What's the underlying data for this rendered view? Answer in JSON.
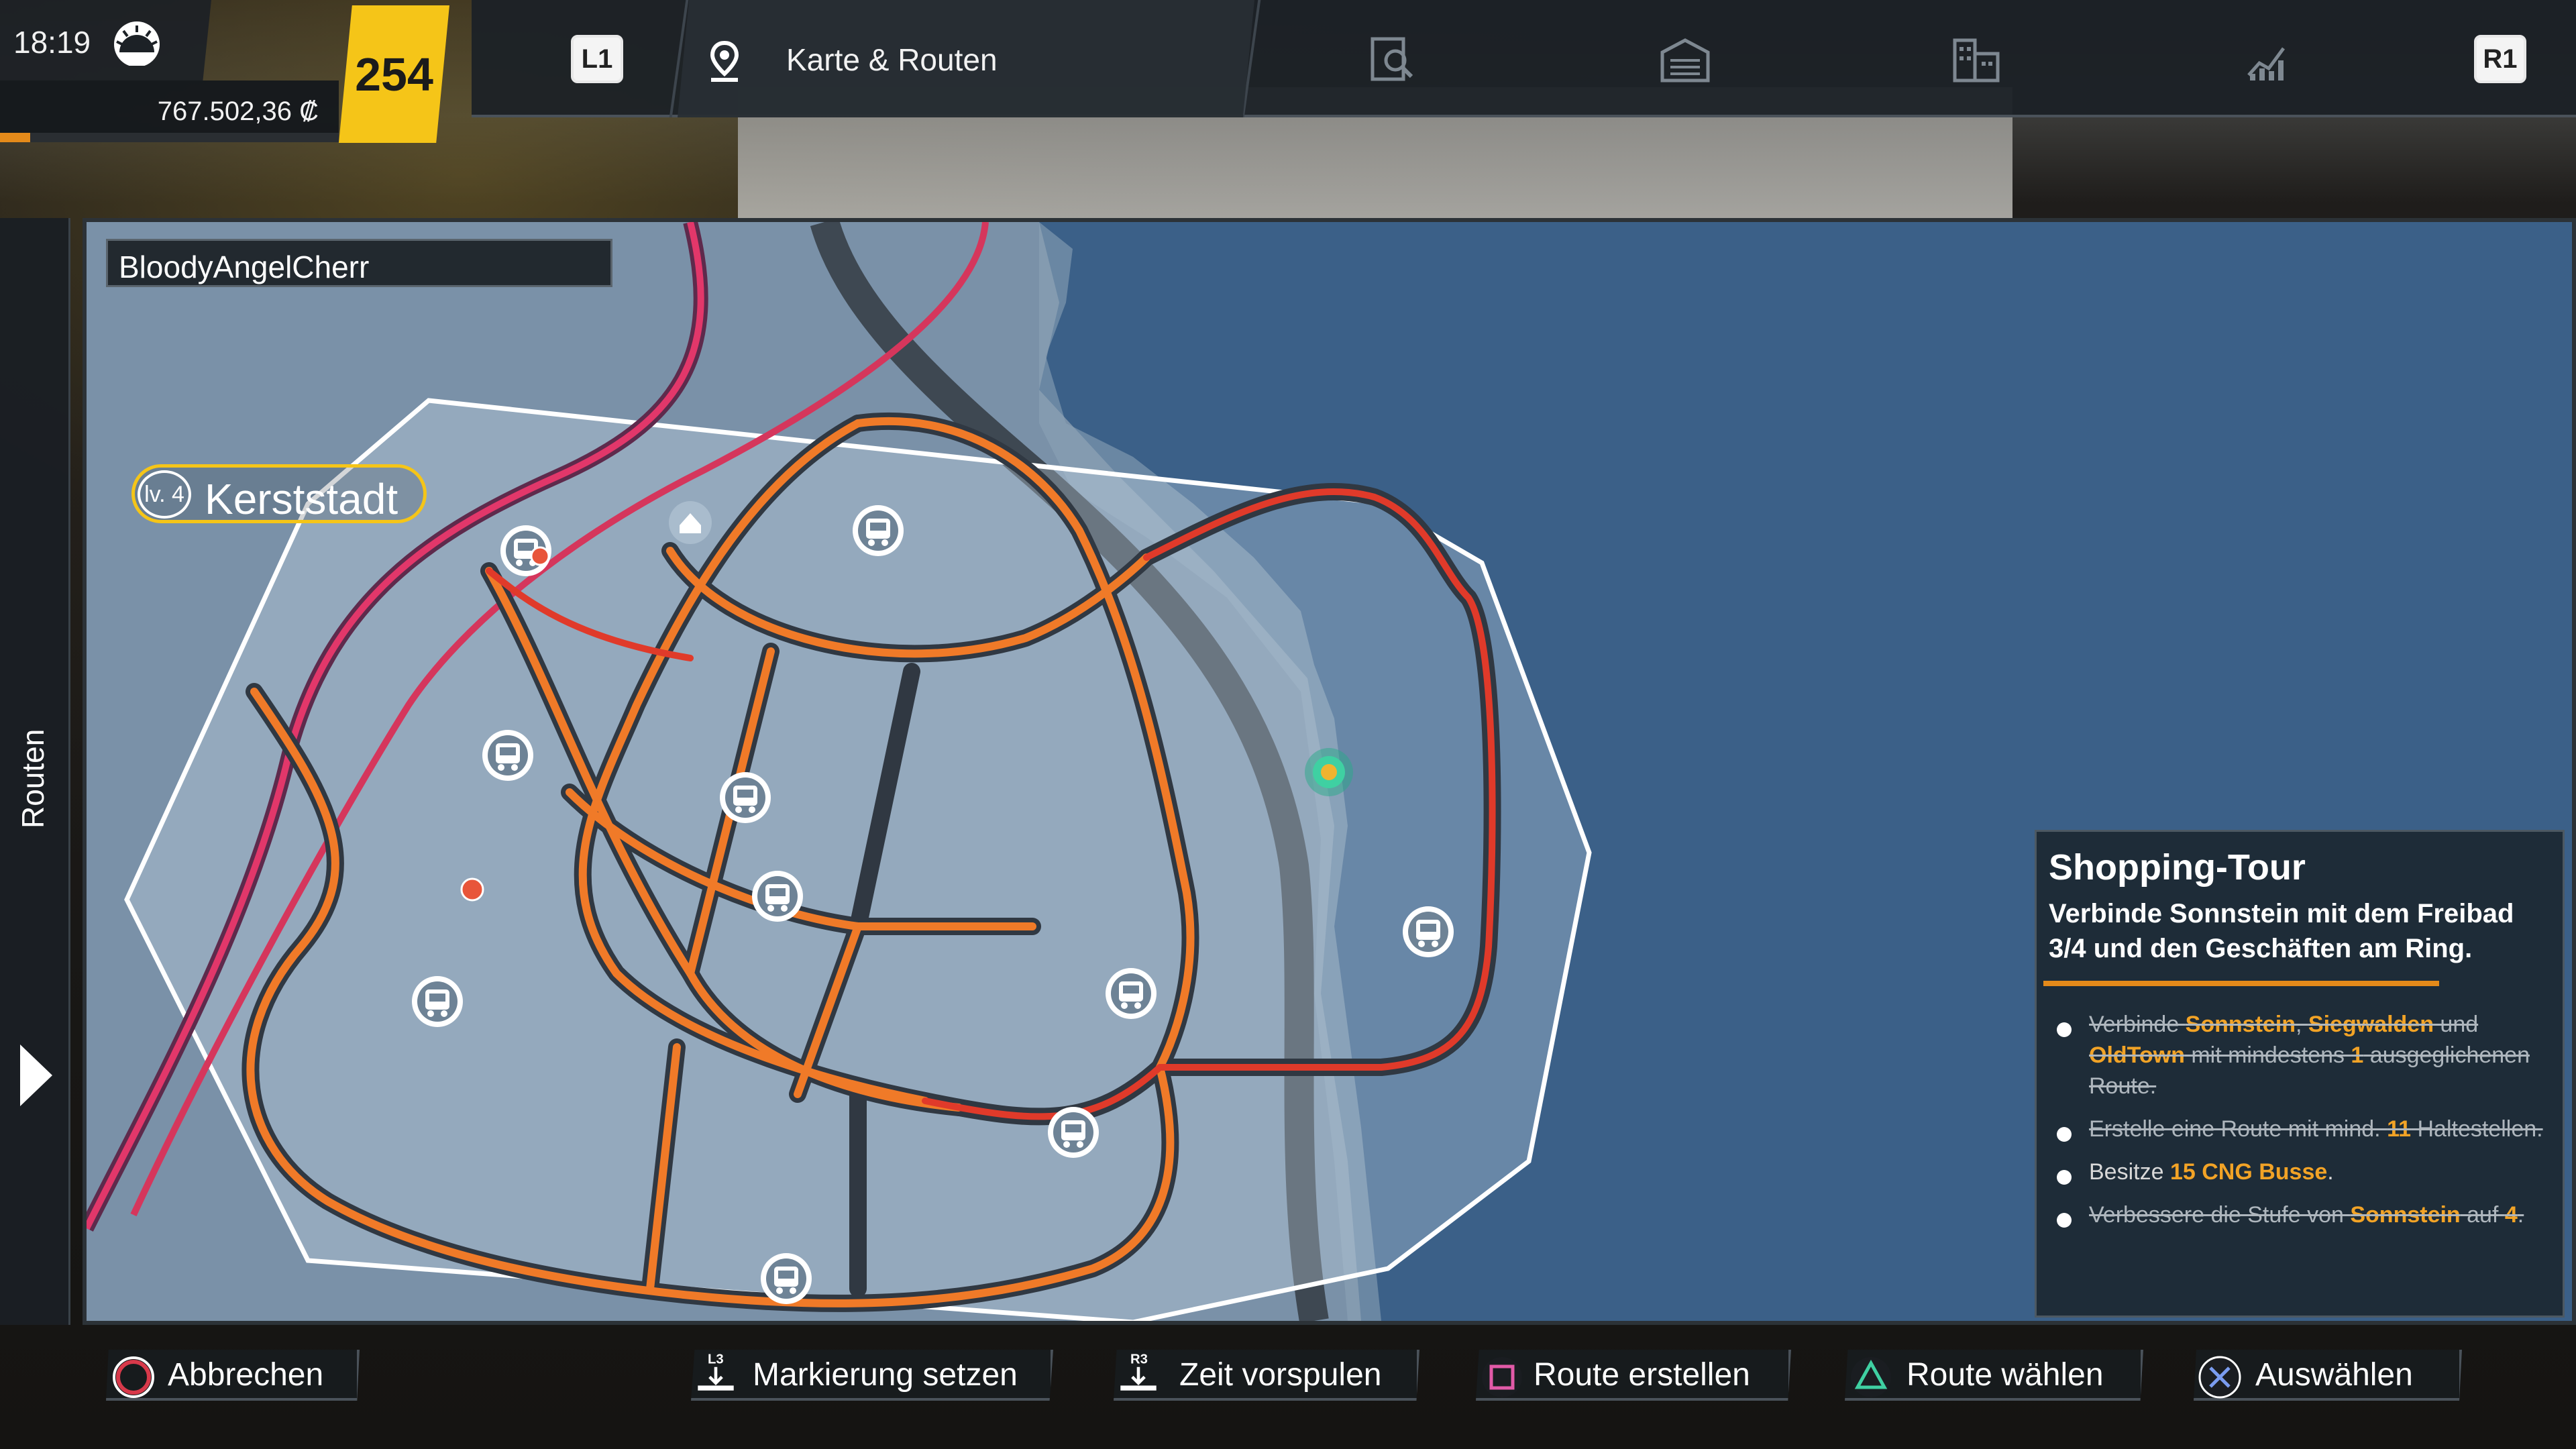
{
  "hud": {
    "time": "18:19",
    "weather_icon": "sun-icon",
    "money": "767.502,36 ₡",
    "level": "254",
    "progress": 0.09
  },
  "tabs": {
    "left_trigger": "L1",
    "right_trigger": "R1",
    "active_label": "Karte & Routen",
    "icons": [
      "map-pin-icon",
      "inspect-icon",
      "depot-icon",
      "buildings-icon",
      "stats-icon"
    ]
  },
  "map": {
    "player_name": "BloodyAngelCherr",
    "city_level": "lv. 4",
    "city_name": "Kerststadt"
  },
  "side_tab": {
    "label": "Routen"
  },
  "quest": {
    "title": "Shopping-Tour",
    "description": "Verbinde Sonnstein mit dem Freibad 3/4 und den Geschäften am Ring.",
    "tasks": [
      {
        "done": true,
        "parts": [
          {
            "t": "Verbinde ",
            "hl": false
          },
          {
            "t": "Sonnstein",
            "hl": true
          },
          {
            "t": ", ",
            "hl": false
          },
          {
            "t": "Siegwalden",
            "hl": true
          },
          {
            "t": " und ",
            "hl": false
          },
          {
            "t": "OldTown",
            "hl": true
          },
          {
            "t": " mit mindestens ",
            "hl": false
          },
          {
            "t": "1",
            "hl": true
          },
          {
            "t": " ausgeglichenen Route.",
            "hl": false
          }
        ]
      },
      {
        "done": true,
        "parts": [
          {
            "t": "Erstelle eine Route mit mind. ",
            "hl": false
          },
          {
            "t": "11",
            "hl": true
          },
          {
            "t": " Haltestellen.",
            "hl": false
          }
        ]
      },
      {
        "done": false,
        "parts": [
          {
            "t": "Besitze ",
            "hl": false
          },
          {
            "t": "15 CNG Busse",
            "hl": true
          },
          {
            "t": ".",
            "hl": false
          }
        ]
      },
      {
        "done": true,
        "parts": [
          {
            "t": "Verbessere die Stufe von ",
            "hl": false
          },
          {
            "t": "Sonnstein",
            "hl": true
          },
          {
            "t": " auf ",
            "hl": false
          },
          {
            "t": "4",
            "hl": true
          },
          {
            "t": ".",
            "hl": false
          }
        ]
      }
    ]
  },
  "controls": {
    "cancel": "Abbrechen",
    "mark": "Markierung setzen",
    "mark_key": "L3",
    "fast_forward": "Zeit vorspulen",
    "fast_forward_key": "R3",
    "create_route": "Route erstellen",
    "choose_route": "Route wählen",
    "select": "Auswählen"
  },
  "colors": {
    "accent_yellow": "#f5c518",
    "accent_orange": "#e48a1a",
    "route_orange": "#f07a28",
    "route_red": "#e03a2a",
    "water": "#3b6088",
    "land": "#7890a8"
  }
}
